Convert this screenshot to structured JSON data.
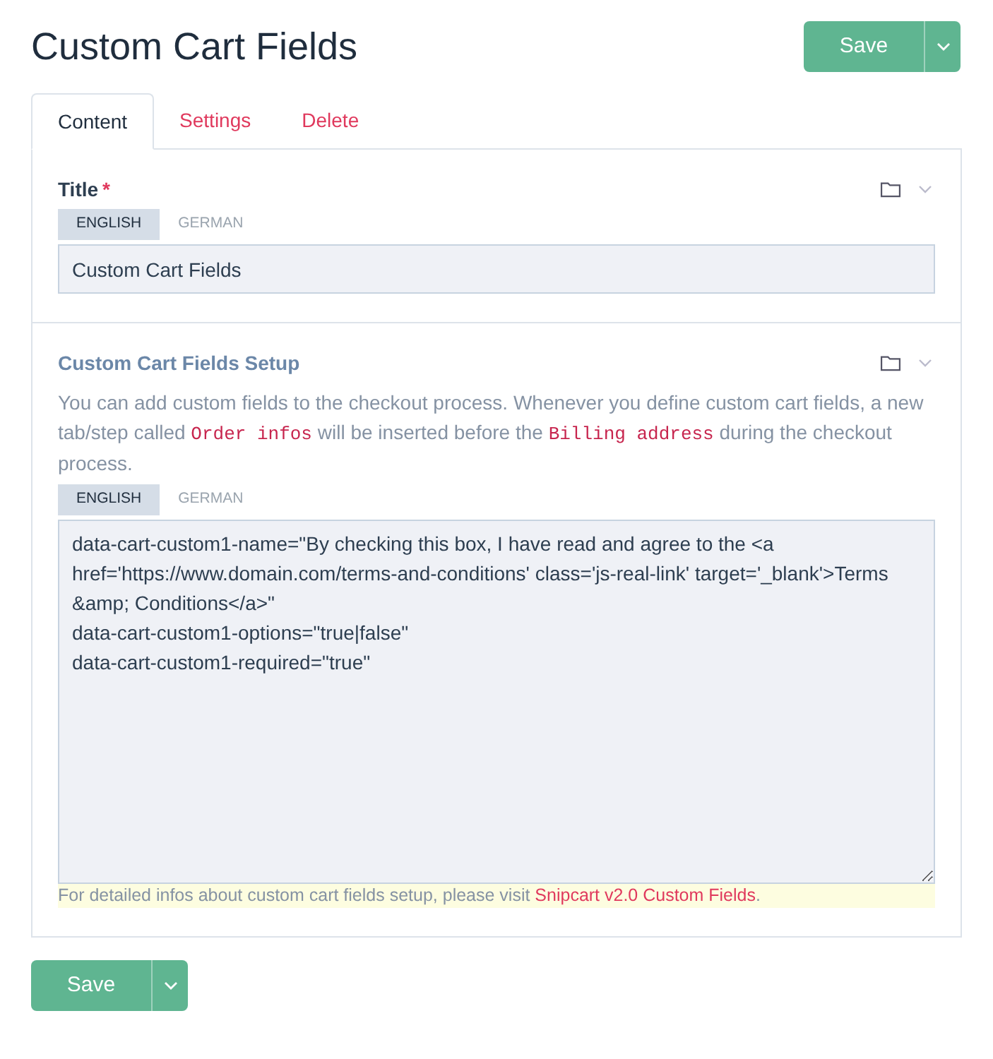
{
  "page_title": "Custom Cart Fields",
  "save_button": {
    "label": "Save"
  },
  "tabs": [
    {
      "label": "Content",
      "selected": true
    },
    {
      "label": "Settings",
      "selected": false
    },
    {
      "label": "Delete",
      "selected": false
    }
  ],
  "fields": [
    {
      "label": "Title",
      "required_mark": "*",
      "languages": [
        {
          "label": "ENGLISH",
          "selected": true
        },
        {
          "label": "GERMAN",
          "selected": false
        }
      ],
      "kind": "input",
      "value": "Custom Cart Fields"
    },
    {
      "label": "Custom Cart Fields Setup",
      "description": [
        {
          "kind": "text",
          "text": "You can add custom fields to the checkout process. Whenever you define custom cart fields, a new tab/step called "
        },
        {
          "kind": "code",
          "text": "Order infos"
        },
        {
          "kind": "text",
          "text": " will be inserted before the "
        },
        {
          "kind": "code",
          "text": "Billing address"
        },
        {
          "kind": "text",
          "text": " during the checkout process."
        }
      ],
      "languages": [
        {
          "label": "ENGLISH",
          "selected": true
        },
        {
          "label": "GERMAN",
          "selected": false
        }
      ],
      "kind": "textarea",
      "value": "data-cart-custom1-name=\"By checking this box, I have read and agree to the <a href='https://www.domain.com/terms-and-conditions' class='js-real-link' target='_blank'>Terms &amp; Conditions</a>\"\ndata-cart-custom1-options=\"true|false\"\ndata-cart-custom1-required=\"true\"",
      "note": [
        {
          "kind": "text",
          "text": "For detailed infos about custom cart fields setup, please visit "
        },
        {
          "kind": "link",
          "text": "Snipcart v2.0 Custom Fields"
        },
        {
          "kind": "text",
          "text": "."
        }
      ]
    }
  ],
  "bottom_save_button": {
    "label": "Save"
  }
}
